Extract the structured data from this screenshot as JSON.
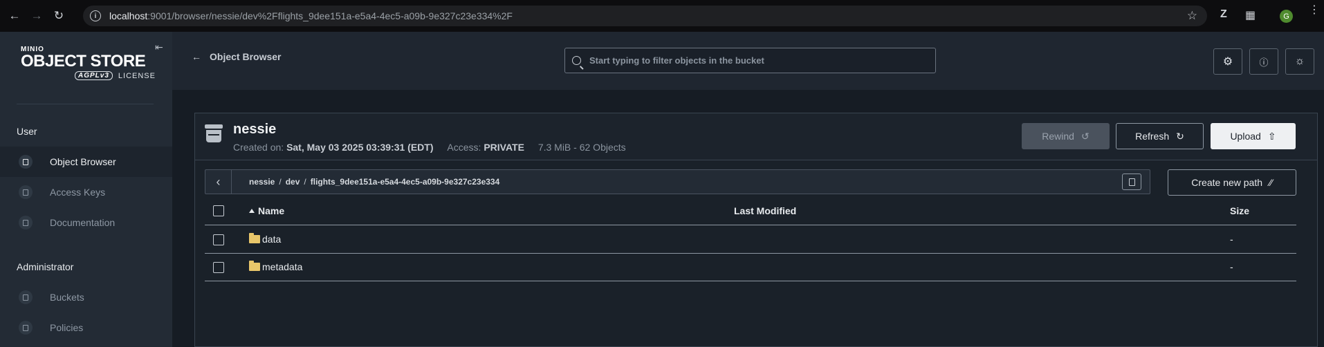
{
  "browser": {
    "url_host": "localhost",
    "url_rest": ":9001/browser/nessie/dev%2Fflights_9dee151a-e5a4-4ec5-a09b-9e327c23e334%2F",
    "profile_initial": "G",
    "ext_z": "Z"
  },
  "sidebar": {
    "brand_small": "MINIO",
    "brand_title": "OBJECT STORE",
    "brand_agpl": "AGPLv3",
    "brand_license": "LICENSE",
    "user_section": "User",
    "admin_section": "Administrator",
    "items": [
      {
        "label": "Object Browser",
        "active": true
      },
      {
        "label": "Access Keys",
        "active": false
      },
      {
        "label": "Documentation",
        "active": false
      },
      {
        "label": "Buckets",
        "active": false
      },
      {
        "label": "Policies",
        "active": false
      }
    ]
  },
  "header": {
    "back_label": "Object Browser",
    "search_placeholder": "Start typing to filter objects in the bucket"
  },
  "bucket": {
    "name": "nessie",
    "created_label": "Created on:",
    "created_value": "Sat, May 03 2025 03:39:31 (EDT)",
    "access_label": "Access:",
    "access_value": "PRIVATE",
    "stats": "7.3 MiB - 62 Objects",
    "rewind_label": "Rewind",
    "refresh_label": "Refresh",
    "upload_label": "Upload"
  },
  "breadcrumb": {
    "parts": [
      "nessie",
      "dev",
      "flights_9dee151a-e5a4-4ec5-a09b-9e327c23e334"
    ],
    "separator": "/",
    "new_path_label": "Create new path"
  },
  "table": {
    "columns": {
      "name": "Name",
      "modified": "Last Modified",
      "size": "Size"
    },
    "rows": [
      {
        "name": "data",
        "modified": "",
        "size": "-"
      },
      {
        "name": "metadata",
        "modified": "",
        "size": "-"
      }
    ]
  }
}
